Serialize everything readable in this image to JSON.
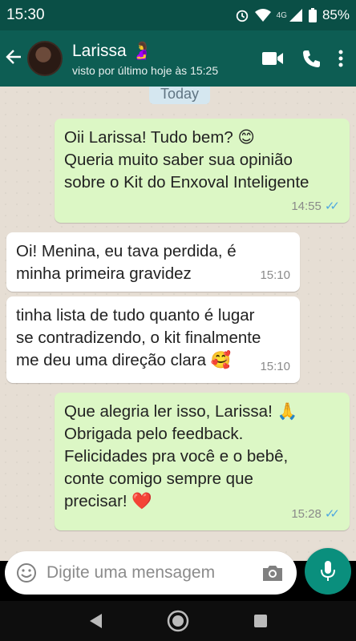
{
  "status_bar": {
    "time": "15:30",
    "network": "4G",
    "battery": "85%"
  },
  "header": {
    "back_icon": "arrow-left-icon",
    "contact_name": "Larissa",
    "contact_emoji": "🤰",
    "last_seen": "visto por último hoje às 15:25",
    "actions": [
      "video-call-icon",
      "phone-icon",
      "more-vert-icon"
    ]
  },
  "chat": {
    "date_chip": "Today",
    "messages": [
      {
        "direction": "out",
        "text": "Oii Larissa! Tudo bem? 😊\nQueria muito saber sua opinião\nsobre o Kit do Enxoval Inteligente",
        "time": "14:55",
        "ticks": "✓✓"
      },
      {
        "direction": "in",
        "text": "Oi! Menina, eu tava perdida, é\nminha primeira gravidez",
        "time": "15:10"
      },
      {
        "direction": "in",
        "text": "tinha lista de tudo quanto é lugar\nse contradizendo, o kit finalmente\nme deu uma direção clara 🥰",
        "time": "15:10"
      },
      {
        "direction": "out",
        "text": "Que alegria ler isso, Larissa! 🙏\nObrigada pelo feedback.\nFelicidades pra você e o bebê,\nconte comigo sempre que\nprecisar! ❤️",
        "time": "15:28",
        "ticks": "✓✓"
      }
    ]
  },
  "input": {
    "placeholder": "Digite uma mensagem"
  },
  "colors": {
    "header": "#0d5d53",
    "outgoing_bubble": "#dcf7c5",
    "incoming_bubble": "#ffffff",
    "mic_button": "#0a8f7d"
  }
}
